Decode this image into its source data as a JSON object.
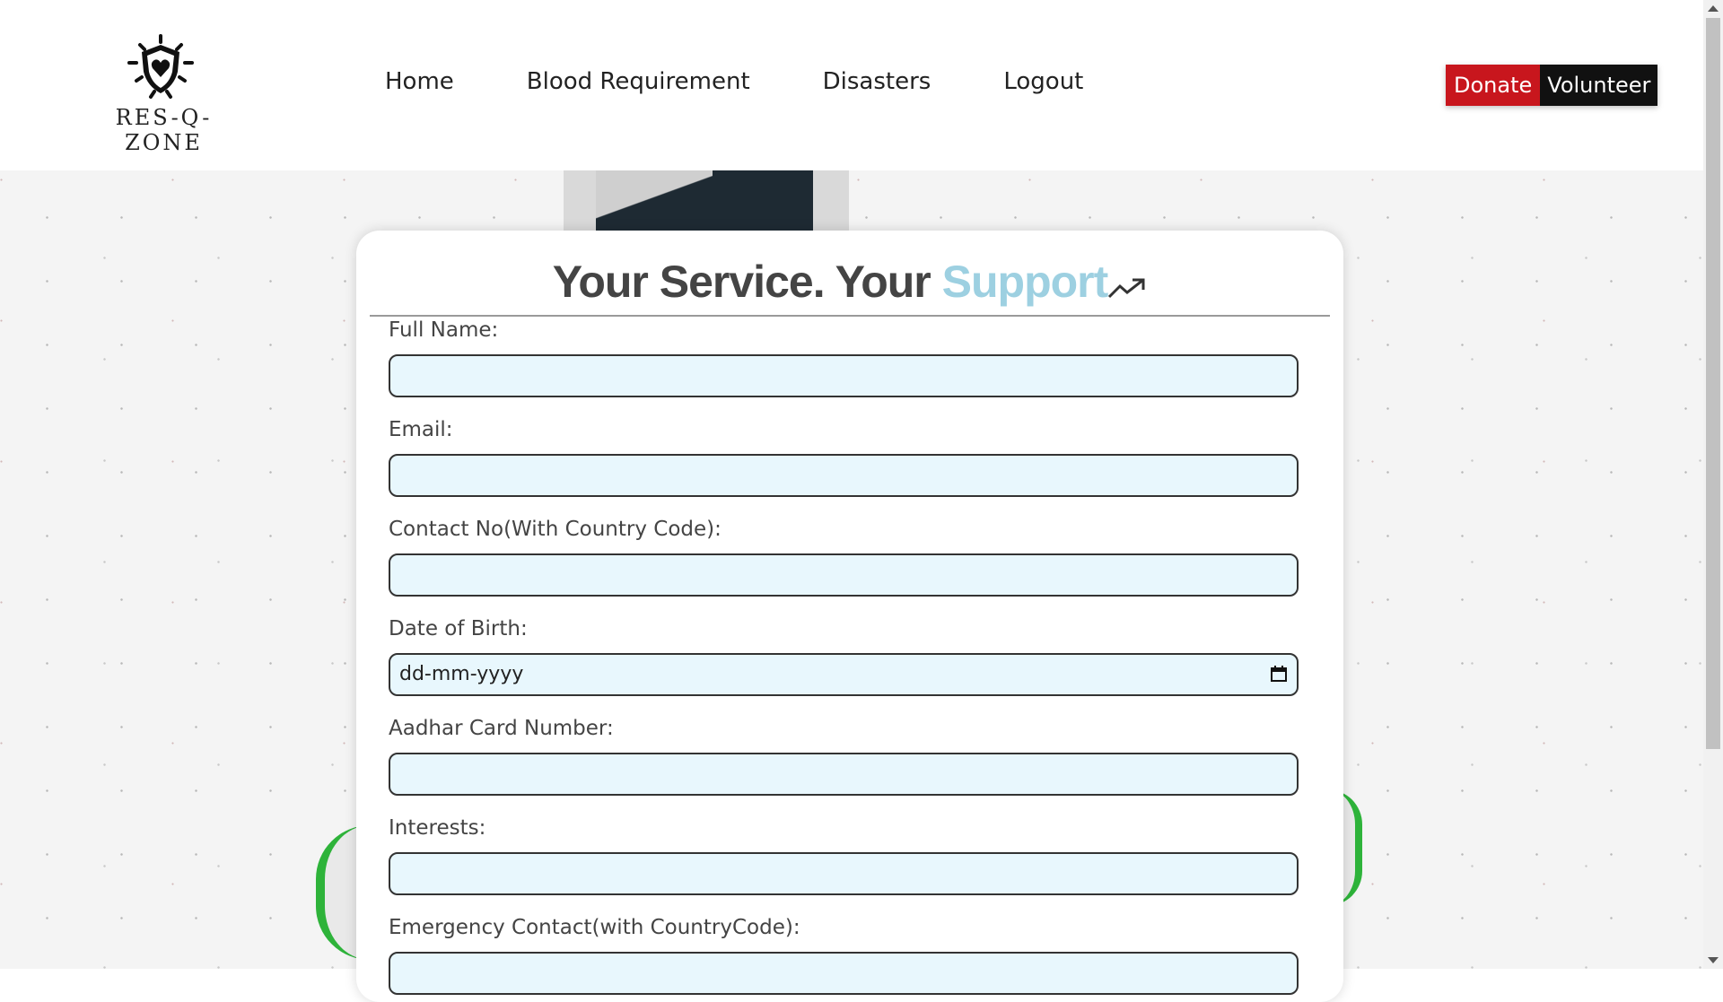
{
  "header": {
    "logo_text": "RES-Q-ZONE",
    "nav": [
      {
        "label": "Home"
      },
      {
        "label": "Blood Requirement"
      },
      {
        "label": "Disasters"
      },
      {
        "label": "Logout"
      }
    ],
    "donate_label": "Donate",
    "volunteer_label": "Volunteer"
  },
  "form": {
    "title_part1": "Your Service. Your ",
    "title_accent": "Support",
    "fields": [
      {
        "label": "Full Name:",
        "value": ""
      },
      {
        "label": "Email:",
        "value": ""
      },
      {
        "label": "Contact No(With Country Code):",
        "value": ""
      },
      {
        "label": "Date of Birth:",
        "value": "dd-mm-yyyy"
      },
      {
        "label": "Aadhar Card Number:",
        "value": ""
      },
      {
        "label": "Interests:",
        "value": ""
      },
      {
        "label": "Emergency Contact(with CountryCode):",
        "value": ""
      }
    ]
  },
  "colors": {
    "donate": "#c8161d",
    "volunteer": "#111111",
    "accent": "#9dd0e1",
    "input_bg": "#e8f7fd"
  },
  "icons": [
    "shield-logo-icon",
    "trending-up-icon",
    "calendar-icon"
  ]
}
